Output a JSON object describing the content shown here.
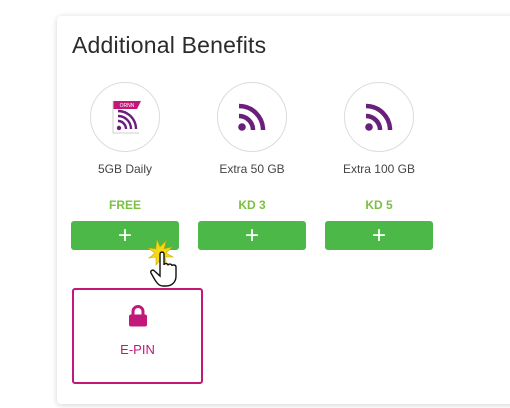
{
  "colors": {
    "accent": "#c2187a",
    "wifi": "#6b1f7c",
    "green_text": "#7ac143",
    "green_button": "#4cb848"
  },
  "section": {
    "title": "Additional Benefits"
  },
  "benefits": [
    {
      "name": "5GB Daily",
      "price": "FREE",
      "icon": "wifi-badge-icon",
      "badge": "ORNN",
      "action": "+"
    },
    {
      "name": "Extra 50 GB",
      "price": "KD 3",
      "icon": "wifi-icon",
      "action": "+"
    },
    {
      "name": "Extra 100 GB",
      "price": "KD 5",
      "icon": "wifi-icon",
      "action": "+"
    }
  ],
  "epin": {
    "label": "E-PIN",
    "icon": "lock-icon"
  },
  "cursor": {
    "icon": "hand-pointer-icon"
  }
}
